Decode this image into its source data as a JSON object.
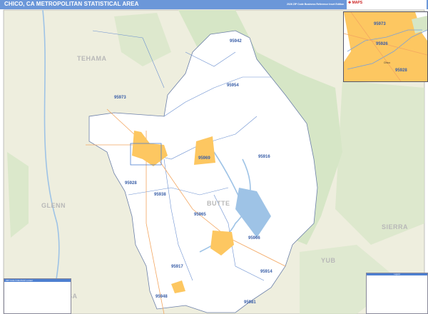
{
  "header": {
    "title": "CHICO, CA METROPOLITAN STATISTICAL AREA",
    "edition": "2026 ZIP Code Business Reference Inset Edition",
    "logo_text": "Market MAPS"
  },
  "map": {
    "county_labels": [
      "TEHAMA",
      "GLENN",
      "BUTTE",
      "SIERRA",
      "YUB",
      "SA"
    ],
    "zip_labels": [
      "95942",
      "95954",
      "95973",
      "95969",
      "95916",
      "95928",
      "95938",
      "95965",
      "95966",
      "95917",
      "95914",
      "95948",
      "95981"
    ],
    "colors": {
      "background": "#eeeede",
      "forest": "#d6e6c6",
      "metro_area": "#ffffff",
      "urban": "#fdc761",
      "water": "#9ec3e6",
      "zip_boundary": "#6a8fd0",
      "highway": "#f3a660",
      "title_bar": "#6b97d9"
    }
  },
  "inset": {
    "zip_labels": [
      "95973",
      "95926",
      "95928"
    ],
    "city_label": "Chico"
  },
  "zip_index": {
    "title": "ZIP Code Index/Grid Locator"
  },
  "legend": {
    "title": "Legend"
  }
}
